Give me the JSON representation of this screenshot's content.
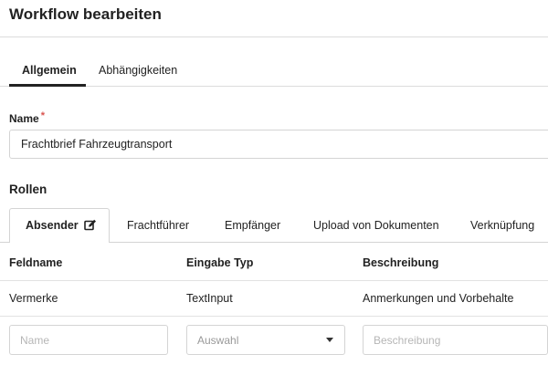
{
  "header": {
    "title": "Workflow bearbeiten"
  },
  "main_tabs": [
    {
      "label": "Allgemein",
      "active": true
    },
    {
      "label": "Abhängigkeiten",
      "active": false
    }
  ],
  "form": {
    "name_label": "Name",
    "required_marker": "*",
    "name_value": "Frachtbrief Fahrzeugtransport"
  },
  "roles": {
    "heading": "Rollen",
    "tabs": [
      {
        "label": "Absender",
        "active": true,
        "icon": "edit-icon"
      },
      {
        "label": "Frachtführer",
        "active": false
      },
      {
        "label": "Empfänger",
        "active": false
      },
      {
        "label": "Upload von Dokumenten",
        "active": false
      },
      {
        "label": "Verknüpfung",
        "active": false
      }
    ]
  },
  "table": {
    "columns": [
      "Feldname",
      "Eingabe Typ",
      "Beschreibung"
    ],
    "rows": [
      [
        "Vermerke",
        "TextInput",
        "Anmerkungen und Vorbehalte"
      ]
    ]
  },
  "new_row": {
    "name_placeholder": "Name",
    "type_placeholder": "Auswahl",
    "description_placeholder": "Beschreibung"
  },
  "colors": {
    "required": "#d9534f",
    "border": "#d4d4d4",
    "text": "#222222"
  }
}
